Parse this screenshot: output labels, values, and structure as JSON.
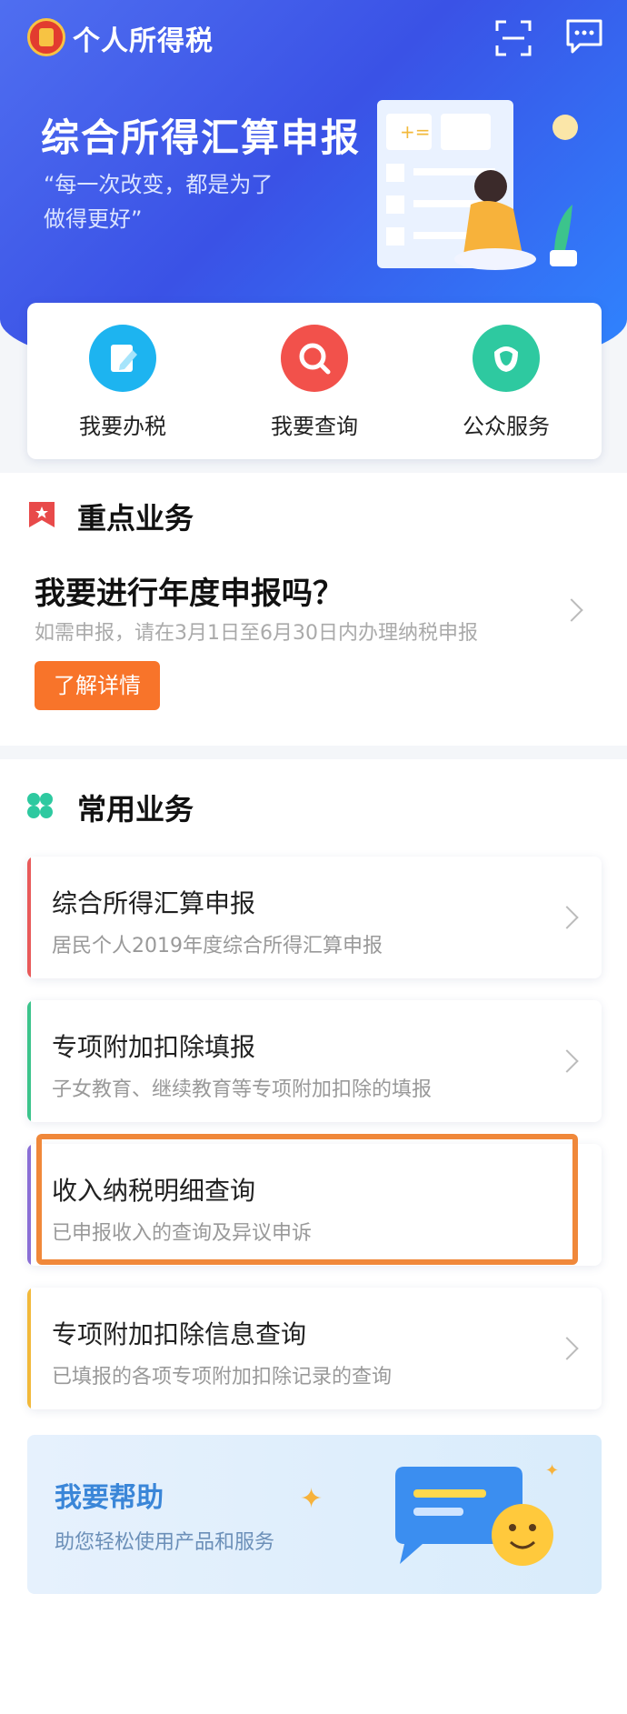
{
  "header": {
    "app_title": "个人所得税",
    "icons": [
      "logo-emblem",
      "scan-icon",
      "message-icon"
    ]
  },
  "banner": {
    "title": "综合所得汇算申报",
    "quote_line1": "“每一次改变，都是为了",
    "quote_line2": "做得更好”"
  },
  "quick_actions": [
    {
      "label": "我要办税",
      "icon": "pencil-icon",
      "color": "#1db4f0"
    },
    {
      "label": "我要查询",
      "icon": "search-icon",
      "color": "#f2514b"
    },
    {
      "label": "公众服务",
      "icon": "flower-icon",
      "color": "#2ec9a0"
    }
  ],
  "key_business": {
    "title": "重点业务",
    "question": "我要进行年度申报吗？",
    "subtitle": "如需申报，请在3月1日至6月30日内办理纳税申报",
    "button": "了解详情"
  },
  "common_business": {
    "title": "常用业务",
    "items": [
      {
        "title": "综合所得汇算申报",
        "desc": "居民个人2019年度综合所得汇算申报",
        "accent": "#e85a5a"
      },
      {
        "title": "专项附加扣除填报",
        "desc": "子女教育、继续教育等专项附加扣除的填报",
        "accent": "#3cc48c"
      },
      {
        "title": "收入纳税明细查询",
        "desc": "已申报收入的查询及异议申诉",
        "accent": "#8a6fd6"
      },
      {
        "title": "专项附加扣除信息查询",
        "desc": "已填报的各项专项附加扣除记录的查询",
        "accent": "#f2b93b"
      }
    ]
  },
  "help": {
    "title": "我要帮助",
    "desc": "助您轻松使用产品和服务"
  },
  "colors": {
    "primary": "#3a52e6",
    "orange": "#f8742a",
    "highlight": "#f0883a"
  }
}
